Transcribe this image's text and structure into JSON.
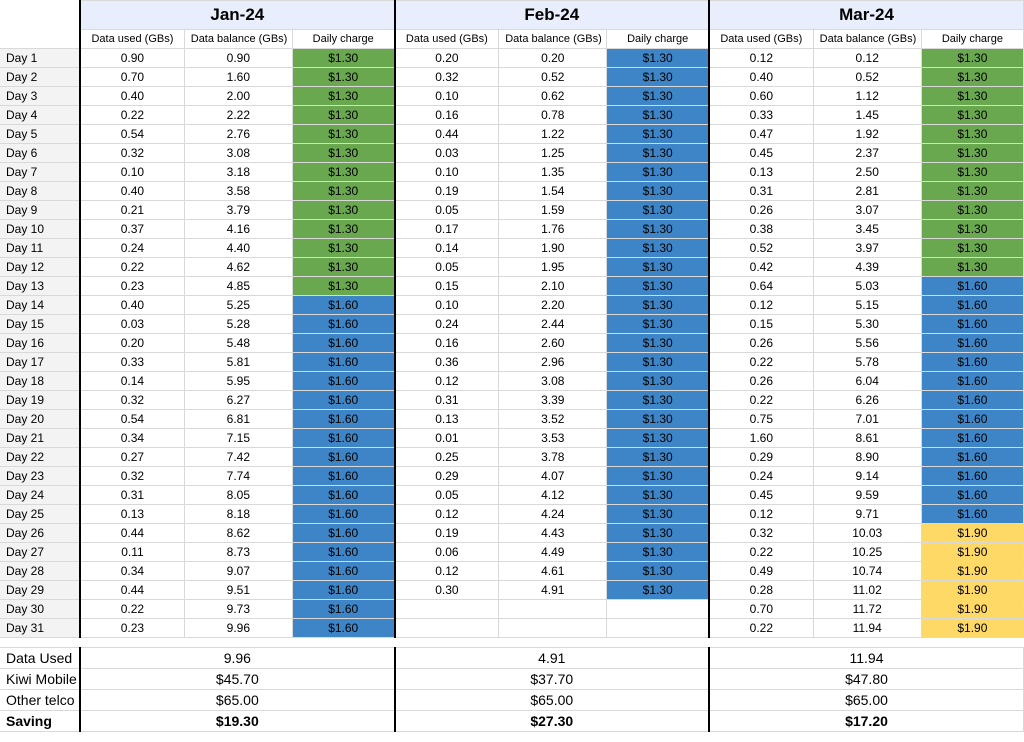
{
  "subHeaders": [
    "Data used (GBs)",
    "Data balance (GBs)",
    "Daily charge"
  ],
  "months": [
    {
      "name": "Jan-24",
      "rows": [
        {
          "used": "0.90",
          "bal": "0.90",
          "chg": "$1.30",
          "cls": "charge-green"
        },
        {
          "used": "0.70",
          "bal": "1.60",
          "chg": "$1.30",
          "cls": "charge-green"
        },
        {
          "used": "0.40",
          "bal": "2.00",
          "chg": "$1.30",
          "cls": "charge-green"
        },
        {
          "used": "0.22",
          "bal": "2.22",
          "chg": "$1.30",
          "cls": "charge-green"
        },
        {
          "used": "0.54",
          "bal": "2.76",
          "chg": "$1.30",
          "cls": "charge-green"
        },
        {
          "used": "0.32",
          "bal": "3.08",
          "chg": "$1.30",
          "cls": "charge-green"
        },
        {
          "used": "0.10",
          "bal": "3.18",
          "chg": "$1.30",
          "cls": "charge-green"
        },
        {
          "used": "0.40",
          "bal": "3.58",
          "chg": "$1.30",
          "cls": "charge-green"
        },
        {
          "used": "0.21",
          "bal": "3.79",
          "chg": "$1.30",
          "cls": "charge-green"
        },
        {
          "used": "0.37",
          "bal": "4.16",
          "chg": "$1.30",
          "cls": "charge-green"
        },
        {
          "used": "0.24",
          "bal": "4.40",
          "chg": "$1.30",
          "cls": "charge-green"
        },
        {
          "used": "0.22",
          "bal": "4.62",
          "chg": "$1.30",
          "cls": "charge-green"
        },
        {
          "used": "0.23",
          "bal": "4.85",
          "chg": "$1.30",
          "cls": "charge-green"
        },
        {
          "used": "0.40",
          "bal": "5.25",
          "chg": "$1.60",
          "cls": "charge-blue"
        },
        {
          "used": "0.03",
          "bal": "5.28",
          "chg": "$1.60",
          "cls": "charge-blue"
        },
        {
          "used": "0.20",
          "bal": "5.48",
          "chg": "$1.60",
          "cls": "charge-blue"
        },
        {
          "used": "0.33",
          "bal": "5.81",
          "chg": "$1.60",
          "cls": "charge-blue"
        },
        {
          "used": "0.14",
          "bal": "5.95",
          "chg": "$1.60",
          "cls": "charge-blue"
        },
        {
          "used": "0.32",
          "bal": "6.27",
          "chg": "$1.60",
          "cls": "charge-blue"
        },
        {
          "used": "0.54",
          "bal": "6.81",
          "chg": "$1.60",
          "cls": "charge-blue"
        },
        {
          "used": "0.34",
          "bal": "7.15",
          "chg": "$1.60",
          "cls": "charge-blue"
        },
        {
          "used": "0.27",
          "bal": "7.42",
          "chg": "$1.60",
          "cls": "charge-blue"
        },
        {
          "used": "0.32",
          "bal": "7.74",
          "chg": "$1.60",
          "cls": "charge-blue"
        },
        {
          "used": "0.31",
          "bal": "8.05",
          "chg": "$1.60",
          "cls": "charge-blue"
        },
        {
          "used": "0.13",
          "bal": "8.18",
          "chg": "$1.60",
          "cls": "charge-blue"
        },
        {
          "used": "0.44",
          "bal": "8.62",
          "chg": "$1.60",
          "cls": "charge-blue"
        },
        {
          "used": "0.11",
          "bal": "8.73",
          "chg": "$1.60",
          "cls": "charge-blue"
        },
        {
          "used": "0.34",
          "bal": "9.07",
          "chg": "$1.60",
          "cls": "charge-blue"
        },
        {
          "used": "0.44",
          "bal": "9.51",
          "chg": "$1.60",
          "cls": "charge-blue"
        },
        {
          "used": "0.22",
          "bal": "9.73",
          "chg": "$1.60",
          "cls": "charge-blue"
        },
        {
          "used": "0.23",
          "bal": "9.96",
          "chg": "$1.60",
          "cls": "charge-blue"
        }
      ],
      "summary": {
        "dataUsed": "9.96",
        "kiwi": "$45.70",
        "other": "$65.00",
        "saving": "$19.30"
      }
    },
    {
      "name": "Feb-24",
      "rows": [
        {
          "used": "0.20",
          "bal": "0.20",
          "chg": "$1.30",
          "cls": "charge-blue"
        },
        {
          "used": "0.32",
          "bal": "0.52",
          "chg": "$1.30",
          "cls": "charge-blue"
        },
        {
          "used": "0.10",
          "bal": "0.62",
          "chg": "$1.30",
          "cls": "charge-blue"
        },
        {
          "used": "0.16",
          "bal": "0.78",
          "chg": "$1.30",
          "cls": "charge-blue"
        },
        {
          "used": "0.44",
          "bal": "1.22",
          "chg": "$1.30",
          "cls": "charge-blue"
        },
        {
          "used": "0.03",
          "bal": "1.25",
          "chg": "$1.30",
          "cls": "charge-blue"
        },
        {
          "used": "0.10",
          "bal": "1.35",
          "chg": "$1.30",
          "cls": "charge-blue"
        },
        {
          "used": "0.19",
          "bal": "1.54",
          "chg": "$1.30",
          "cls": "charge-blue"
        },
        {
          "used": "0.05",
          "bal": "1.59",
          "chg": "$1.30",
          "cls": "charge-blue"
        },
        {
          "used": "0.17",
          "bal": "1.76",
          "chg": "$1.30",
          "cls": "charge-blue"
        },
        {
          "used": "0.14",
          "bal": "1.90",
          "chg": "$1.30",
          "cls": "charge-blue"
        },
        {
          "used": "0.05",
          "bal": "1.95",
          "chg": "$1.30",
          "cls": "charge-blue"
        },
        {
          "used": "0.15",
          "bal": "2.10",
          "chg": "$1.30",
          "cls": "charge-blue"
        },
        {
          "used": "0.10",
          "bal": "2.20",
          "chg": "$1.30",
          "cls": "charge-blue"
        },
        {
          "used": "0.24",
          "bal": "2.44",
          "chg": "$1.30",
          "cls": "charge-blue"
        },
        {
          "used": "0.16",
          "bal": "2.60",
          "chg": "$1.30",
          "cls": "charge-blue"
        },
        {
          "used": "0.36",
          "bal": "2.96",
          "chg": "$1.30",
          "cls": "charge-blue"
        },
        {
          "used": "0.12",
          "bal": "3.08",
          "chg": "$1.30",
          "cls": "charge-blue"
        },
        {
          "used": "0.31",
          "bal": "3.39",
          "chg": "$1.30",
          "cls": "charge-blue"
        },
        {
          "used": "0.13",
          "bal": "3.52",
          "chg": "$1.30",
          "cls": "charge-blue"
        },
        {
          "used": "0.01",
          "bal": "3.53",
          "chg": "$1.30",
          "cls": "charge-blue"
        },
        {
          "used": "0.25",
          "bal": "3.78",
          "chg": "$1.30",
          "cls": "charge-blue"
        },
        {
          "used": "0.29",
          "bal": "4.07",
          "chg": "$1.30",
          "cls": "charge-blue"
        },
        {
          "used": "0.05",
          "bal": "4.12",
          "chg": "$1.30",
          "cls": "charge-blue"
        },
        {
          "used": "0.12",
          "bal": "4.24",
          "chg": "$1.30",
          "cls": "charge-blue"
        },
        {
          "used": "0.19",
          "bal": "4.43",
          "chg": "$1.30",
          "cls": "charge-blue"
        },
        {
          "used": "0.06",
          "bal": "4.49",
          "chg": "$1.30",
          "cls": "charge-blue"
        },
        {
          "used": "0.12",
          "bal": "4.61",
          "chg": "$1.30",
          "cls": "charge-blue"
        },
        {
          "used": "0.30",
          "bal": "4.91",
          "chg": "$1.30",
          "cls": "charge-blue"
        },
        {
          "used": "",
          "bal": "",
          "chg": "",
          "cls": ""
        },
        {
          "used": "",
          "bal": "",
          "chg": "",
          "cls": ""
        }
      ],
      "summary": {
        "dataUsed": "4.91",
        "kiwi": "$37.70",
        "other": "$65.00",
        "saving": "$27.30"
      }
    },
    {
      "name": "Mar-24",
      "rows": [
        {
          "used": "0.12",
          "bal": "0.12",
          "chg": "$1.30",
          "cls": "charge-green"
        },
        {
          "used": "0.40",
          "bal": "0.52",
          "chg": "$1.30",
          "cls": "charge-green"
        },
        {
          "used": "0.60",
          "bal": "1.12",
          "chg": "$1.30",
          "cls": "charge-green"
        },
        {
          "used": "0.33",
          "bal": "1.45",
          "chg": "$1.30",
          "cls": "charge-green"
        },
        {
          "used": "0.47",
          "bal": "1.92",
          "chg": "$1.30",
          "cls": "charge-green"
        },
        {
          "used": "0.45",
          "bal": "2.37",
          "chg": "$1.30",
          "cls": "charge-green"
        },
        {
          "used": "0.13",
          "bal": "2.50",
          "chg": "$1.30",
          "cls": "charge-green"
        },
        {
          "used": "0.31",
          "bal": "2.81",
          "chg": "$1.30",
          "cls": "charge-green"
        },
        {
          "used": "0.26",
          "bal": "3.07",
          "chg": "$1.30",
          "cls": "charge-green"
        },
        {
          "used": "0.38",
          "bal": "3.45",
          "chg": "$1.30",
          "cls": "charge-green"
        },
        {
          "used": "0.52",
          "bal": "3.97",
          "chg": "$1.30",
          "cls": "charge-green"
        },
        {
          "used": "0.42",
          "bal": "4.39",
          "chg": "$1.30",
          "cls": "charge-green"
        },
        {
          "used": "0.64",
          "bal": "5.03",
          "chg": "$1.60",
          "cls": "charge-blue"
        },
        {
          "used": "0.12",
          "bal": "5.15",
          "chg": "$1.60",
          "cls": "charge-blue"
        },
        {
          "used": "0.15",
          "bal": "5.30",
          "chg": "$1.60",
          "cls": "charge-blue"
        },
        {
          "used": "0.26",
          "bal": "5.56",
          "chg": "$1.60",
          "cls": "charge-blue"
        },
        {
          "used": "0.22",
          "bal": "5.78",
          "chg": "$1.60",
          "cls": "charge-blue"
        },
        {
          "used": "0.26",
          "bal": "6.04",
          "chg": "$1.60",
          "cls": "charge-blue"
        },
        {
          "used": "0.22",
          "bal": "6.26",
          "chg": "$1.60",
          "cls": "charge-blue"
        },
        {
          "used": "0.75",
          "bal": "7.01",
          "chg": "$1.60",
          "cls": "charge-blue"
        },
        {
          "used": "1.60",
          "bal": "8.61",
          "chg": "$1.60",
          "cls": "charge-blue"
        },
        {
          "used": "0.29",
          "bal": "8.90",
          "chg": "$1.60",
          "cls": "charge-blue"
        },
        {
          "used": "0.24",
          "bal": "9.14",
          "chg": "$1.60",
          "cls": "charge-blue"
        },
        {
          "used": "0.45",
          "bal": "9.59",
          "chg": "$1.60",
          "cls": "charge-blue"
        },
        {
          "used": "0.12",
          "bal": "9.71",
          "chg": "$1.60",
          "cls": "charge-blue"
        },
        {
          "used": "0.32",
          "bal": "10.03",
          "chg": "$1.90",
          "cls": "charge-yellow"
        },
        {
          "used": "0.22",
          "bal": "10.25",
          "chg": "$1.90",
          "cls": "charge-yellow"
        },
        {
          "used": "0.49",
          "bal": "10.74",
          "chg": "$1.90",
          "cls": "charge-yellow"
        },
        {
          "used": "0.28",
          "bal": "11.02",
          "chg": "$1.90",
          "cls": "charge-yellow"
        },
        {
          "used": "0.70",
          "bal": "11.72",
          "chg": "$1.90",
          "cls": "charge-yellow"
        },
        {
          "used": "0.22",
          "bal": "11.94",
          "chg": "$1.90",
          "cls": "charge-yellow"
        }
      ],
      "summary": {
        "dataUsed": "11.94",
        "kiwi": "$47.80",
        "other": "$65.00",
        "saving": "$17.20"
      }
    }
  ],
  "dayLabelPrefix": "Day ",
  "summaryLabels": {
    "dataUsed": "Data Used",
    "kiwi": "Kiwi Mobile",
    "other": "Other telco",
    "saving": "Saving"
  }
}
